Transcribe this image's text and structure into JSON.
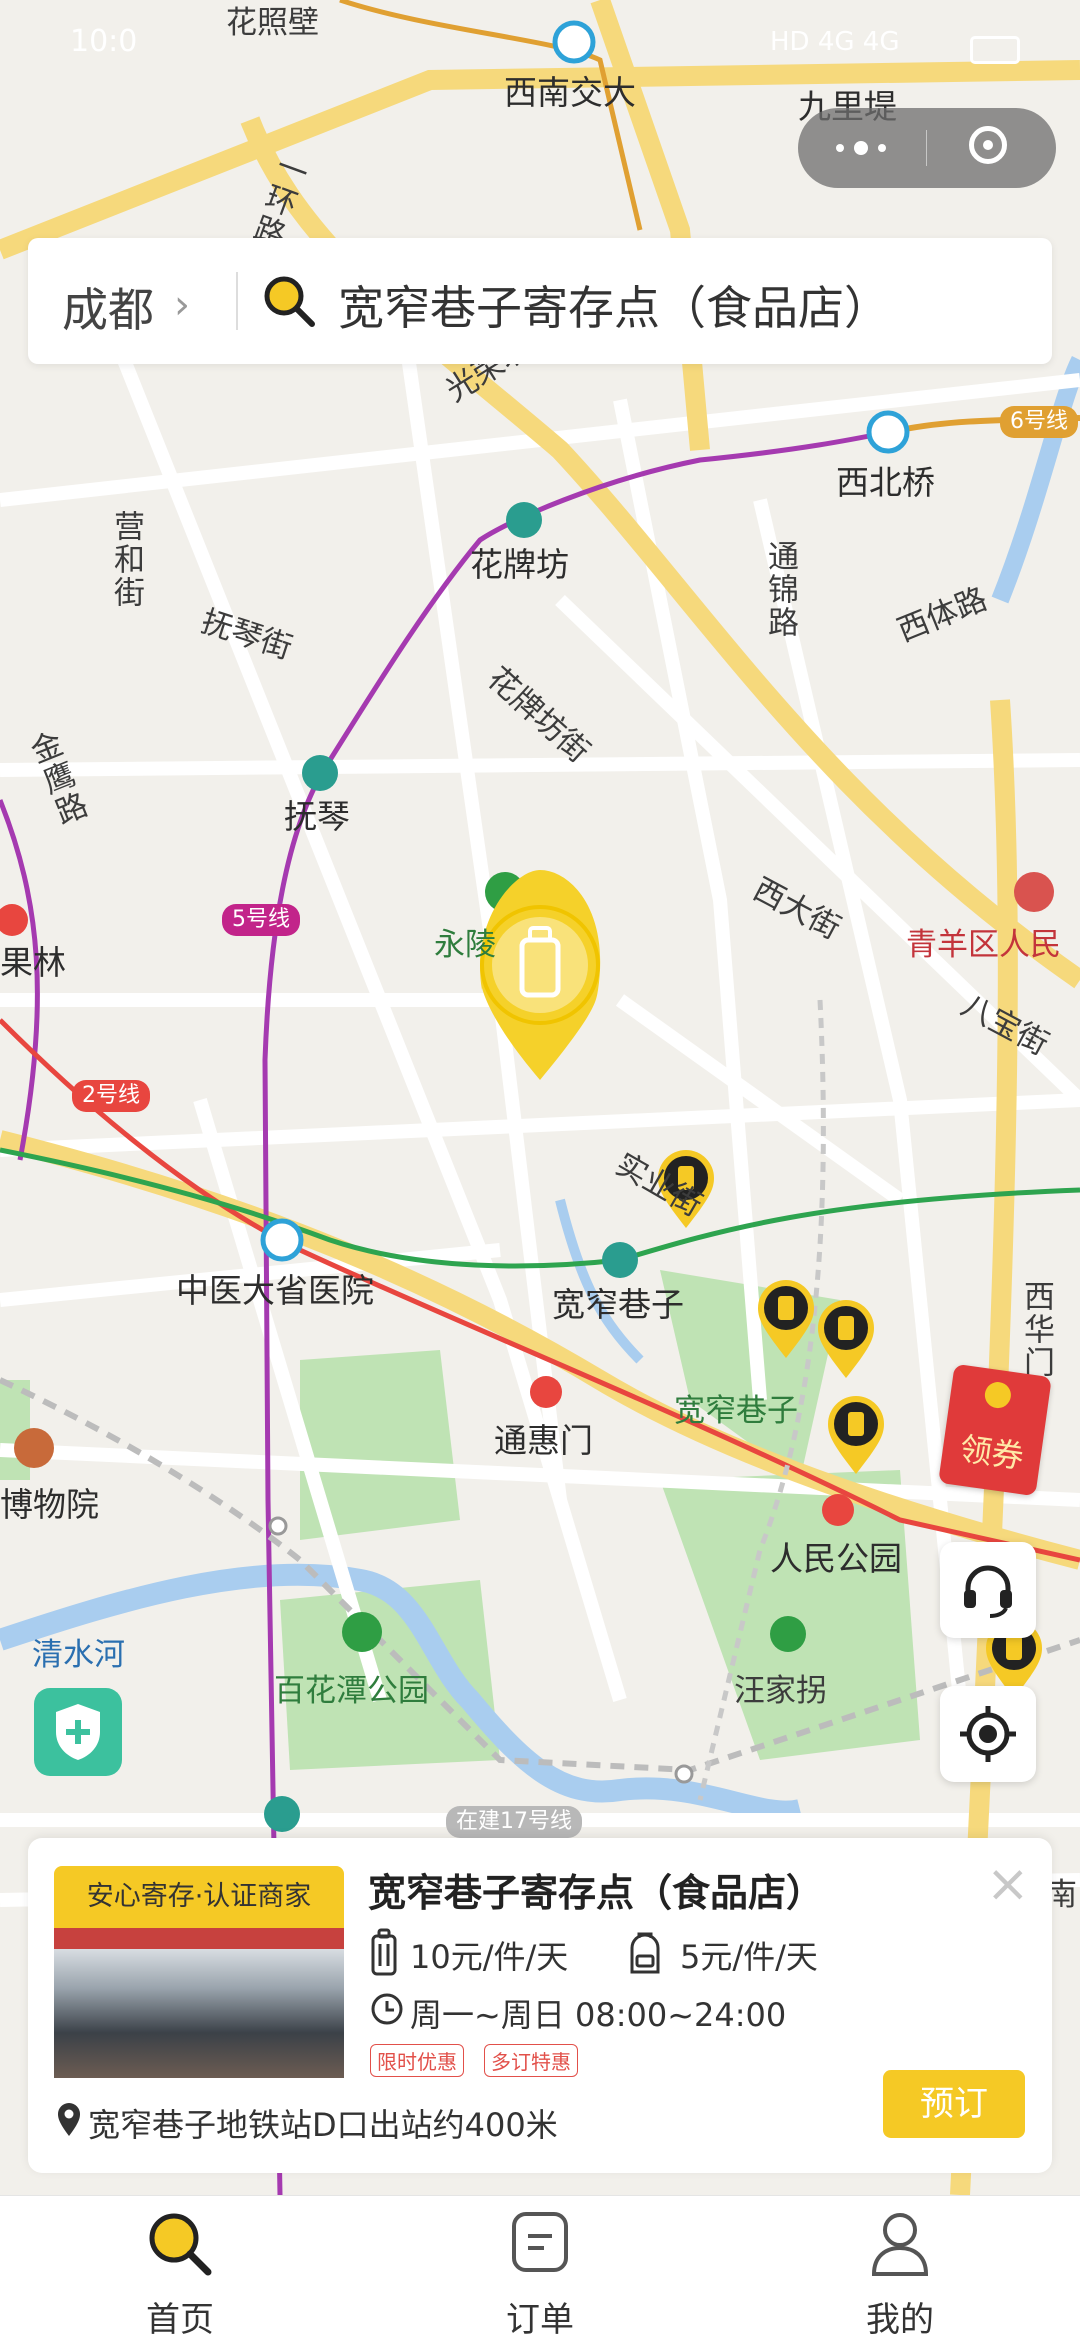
{
  "status_bar": {
    "time": "10:0",
    "indicators": "HD 4G 4G"
  },
  "search": {
    "city": "成都",
    "query": "宽窄巷子寄存点（食品店）"
  },
  "map": {
    "places": [
      "花照壁",
      "西南交大",
      "九里堤",
      "西北桥",
      "花牌坊",
      "通锦路",
      "西体路",
      "抚琴街",
      "花牌坊街",
      "抚琴",
      "金鹰路",
      "果林",
      "永陵",
      "西大街",
      "青羊区人民",
      "八宝街",
      "中医大省医院",
      "宽窄巷子",
      "宽窄巷子",
      "通惠门",
      "人民公园",
      "博物院",
      "清水河",
      "百花潭公园",
      "汪家拐",
      "西华门",
      "光荣北路",
      "营和街",
      "实业街",
      "南",
      "一环路"
    ],
    "lines": [
      "6号线",
      "5号线",
      "2号线",
      "在建17号线"
    ],
    "promo_label": "领券"
  },
  "card": {
    "tag": "安心寄存·认证商家",
    "title": "宽窄巷子寄存点（食品店）",
    "price_suitcase": "10元/件/天",
    "price_backpack": "5元/件/天",
    "hours": "周一~周日 08:00~24:00",
    "promo_1": "限时优惠",
    "promo_2": "多订特惠",
    "address": "宽窄巷子地铁站D口出站约400米",
    "book_label": "预订",
    "close": "×"
  },
  "tabbar": {
    "home": "首页",
    "orders": "订单",
    "mine": "我的"
  },
  "colors": {
    "accent": "#f5c925",
    "line2": "#e8463f",
    "line4": "#2ea44f",
    "line5": "#a53ab0",
    "line6": "#e0a032",
    "line17": "#b8b8b8"
  }
}
